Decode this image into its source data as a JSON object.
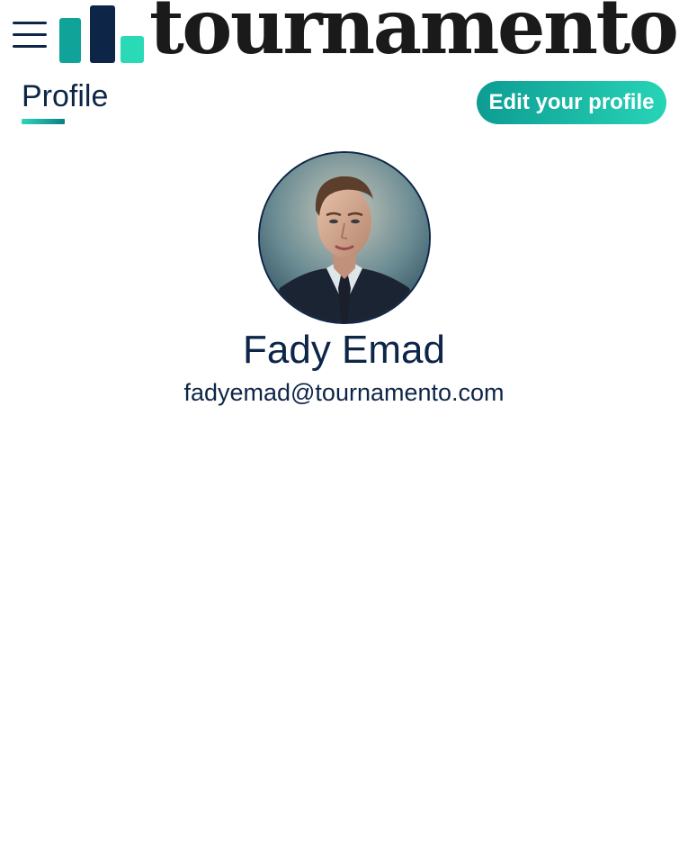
{
  "header": {
    "menu_icon": "hamburger-menu-icon",
    "logo_text": "tournamento",
    "logo_colors": {
      "bar_left": "#10a39a",
      "bar_middle": "#0d2547",
      "bar_right": "#2ad9b6",
      "text": "#1a1a1a"
    }
  },
  "page": {
    "title": "Profile",
    "edit_button_label": "Edit your profile"
  },
  "profile": {
    "name": "Fady Emad",
    "email": "fadyemad@tournamento.com"
  },
  "colors": {
    "primary_text": "#0d2547",
    "accent_start": "#0d9c93",
    "accent_end": "#27d4b6",
    "background": "#ffffff"
  }
}
